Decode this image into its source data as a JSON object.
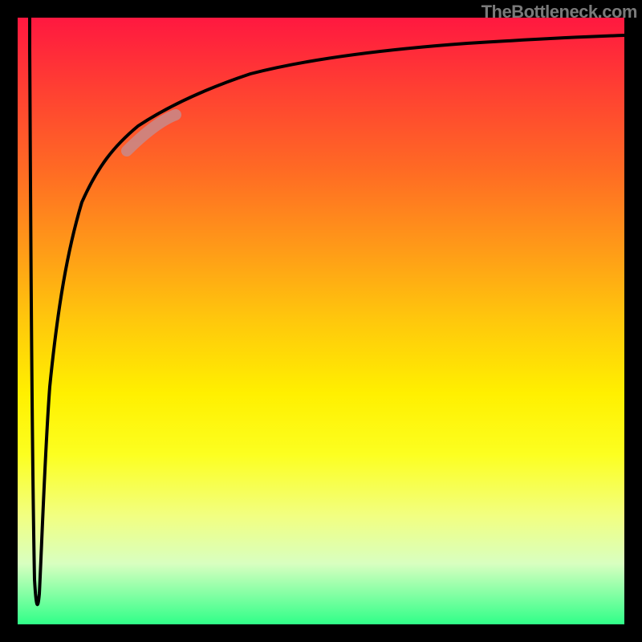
{
  "attribution": "TheBottleneck.com",
  "colors": {
    "frame": "#000000",
    "gradient_top": "#ff1840",
    "gradient_mid": "#fff000",
    "gradient_bottom": "#30ff88",
    "curve": "#000000",
    "highlight": "#c88a8a"
  },
  "chart_data": {
    "type": "line",
    "title": "",
    "xlabel": "",
    "ylabel": "",
    "xlim": [
      0,
      100
    ],
    "ylim": [
      0,
      100
    ],
    "series": [
      {
        "name": "bottleneck-curve",
        "x": [
          2.0,
          2.5,
          3.0,
          3.3,
          3.5,
          4.0,
          5.0,
          6.5,
          8.0,
          10.0,
          12.0,
          15.0,
          18.0,
          22.0,
          26.0,
          32.0,
          40.0,
          50.0,
          60.0,
          72.0,
          85.0,
          100.0
        ],
        "y": [
          100,
          60,
          20,
          5,
          3,
          10,
          28,
          45,
          55,
          63,
          69,
          74,
          78,
          82,
          84,
          87,
          89,
          91,
          92.5,
          93.8,
          94.6,
          95.2
        ]
      }
    ],
    "annotations": [
      {
        "name": "highlight-segment",
        "x_range": [
          18,
          26
        ],
        "note": "thick pale segment on rising shoulder"
      }
    ]
  }
}
